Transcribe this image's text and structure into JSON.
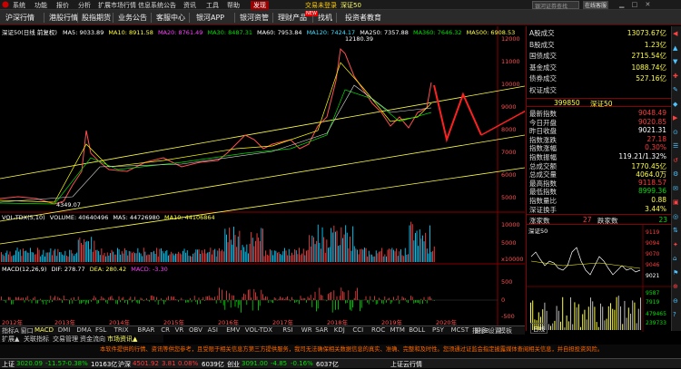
{
  "menu": {
    "items": [
      "系统",
      "功能",
      "报价",
      "分析",
      "扩展市场行情",
      "信息系统公告",
      "资讯",
      "工具",
      "帮助"
    ],
    "hot_label": "发现",
    "login_status": "交易未登录",
    "symbol": "深证50",
    "search_placeholder": "银河证券查找",
    "account_btn": "在线客服"
  },
  "tabs": [
    "沪深行情",
    "港股行情",
    "股指期货",
    "业务公告",
    "客服中心",
    "银河APP",
    "银河资管",
    "理财产品",
    "找机",
    "投资者教育"
  ],
  "tab_new_badge": "NEW",
  "main_legend": {
    "title": "深证50(日线 前复权)",
    "ma5": "MA5: 9033.89",
    "ma10": "MA10: 8911.58",
    "ma20": "MA20: 8761.49",
    "ma30": "MA30: 8487.31",
    "ma60": "MA60: 7953.84",
    "ma120": "MA120: 7424.17",
    "ma250": "MA250: 7357.88",
    "ma360": "MA360: 7646.32",
    "ma500": "MA500: 6908.53"
  },
  "price_annotations": {
    "high": "12180.39",
    "low": "4349.07"
  },
  "price_axis": [
    "12000",
    "11000",
    "10000",
    "9000",
    "8000",
    "7000",
    "6000",
    "5000"
  ],
  "volume_legend": {
    "label": "VOL-TDX(5,10)",
    "volume": "VOLUME: 40640496",
    "ma5": "MA5: 44726980",
    "ma10": "MA10: 44106864"
  },
  "volume_axis": [
    "10000",
    "5000",
    "x10000"
  ],
  "macd_legend": {
    "label": "MACD(12,26,9)",
    "dif": "DIF: 278.77",
    "dea": "DEA: 280.42",
    "macd": "MACD: -3.30"
  },
  "macd_axis": [
    "500",
    "0",
    "-500"
  ],
  "x_axis_years": [
    "2012年",
    "2013年",
    "2014年",
    "2015年",
    "2016年",
    "2017年",
    "2018年",
    "2019年",
    "2020年"
  ],
  "indicator_tabs": [
    "指标A",
    "窗口",
    "MACD",
    "DMI",
    "DMA",
    "FSL",
    "TRIX",
    "BRAR",
    "CR",
    "VR",
    "OBV",
    "ASI",
    "EMV",
    "VOL-TDX",
    "RSI",
    "WR",
    "SAR",
    "KDJ",
    "CCI",
    "ROC",
    "MTM",
    "BOLL",
    "PSY",
    "MCST",
    "更多",
    "设置"
  ],
  "bottom_tabs": [
    "扩展▲",
    "关联指标",
    "交易管理",
    "资金流向",
    "市场资讯▲"
  ],
  "bottom_right_tabs": [
    "指标B",
    "模板"
  ],
  "right_panel": {
    "volumes": [
      {
        "label": "A股成交",
        "value": "13073.67亿"
      },
      {
        "label": "B股成交",
        "value": "1.23亿"
      },
      {
        "label": "国债成交",
        "value": "2715.54亿"
      },
      {
        "label": "基金成交",
        "value": "1088.74亿"
      },
      {
        "label": "债券成交",
        "value": "527.16亿"
      },
      {
        "label": "权证成交",
        "value": ""
      }
    ],
    "index_code": "399850",
    "index_name": "深证50",
    "stats": [
      {
        "label": "最新指数",
        "value": "9048.49",
        "color": "red"
      },
      {
        "label": "今日开盘",
        "value": "9020.85",
        "color": "red"
      },
      {
        "label": "昨日收盘",
        "value": "9021.31",
        "color": "wht"
      },
      {
        "label": "指数涨跌",
        "value": "27.18",
        "color": "red"
      },
      {
        "label": "指数涨幅",
        "value": "0.30%",
        "color": "red"
      },
      {
        "label": "指数振幅",
        "value": "119.21/1.32%",
        "color": "wht"
      },
      {
        "label": "总成交额",
        "value": "1770.45亿",
        "color": "yel"
      },
      {
        "label": "总成交量",
        "value": "4064.0万",
        "color": "yel"
      },
      {
        "label": "最高指数",
        "value": "9118.57",
        "color": "red"
      },
      {
        "label": "最低指数",
        "value": "8999.36",
        "color": "grn"
      },
      {
        "label": "指数量比",
        "value": "0.88",
        "color": "yel"
      },
      {
        "label": "深证换手",
        "value": "3.44%",
        "color": "yel"
      }
    ],
    "rise_label": "涨家数",
    "rise_value": "27",
    "fall_label": "跌家数",
    "fall_value": "23",
    "mini_title": "深证50",
    "mini_price_axis": [
      "9119",
      "9094",
      "9070",
      "9046",
      "9021"
    ],
    "mini_vol_axis": [
      "9587",
      "7919",
      "479465",
      "239733"
    ],
    "mini_tab": "日线"
  },
  "notice": "本软件提供的行情、资讯等供您参考，且受限于相关信息方第三方提供服务，我司无法确保相关数据信息的真实、准确、完整和及时性。您须通过证监会指定披露媒体查阅相关信息，并自担投资风险。",
  "statusbar": {
    "sh": {
      "name": "上证",
      "value": "3020.09",
      "chg": "-11.57",
      "pct": "-0.38%",
      "vol": "10163亿"
    },
    "hs": {
      "name": "沪深",
      "value": "4501.92",
      "chg": "3.81",
      "pct": "0.08%",
      "vol": "6039亿"
    },
    "cy": {
      "name": "创业",
      "value": "3091.00",
      "chg": "-4.85",
      "pct": "-0.16%",
      "vol": "6037亿"
    },
    "server": "上证云行情"
  },
  "colors": {
    "up": "#ff3c3c",
    "down": "#00e000",
    "accent": "#800000",
    "yellow": "#ffff40"
  }
}
